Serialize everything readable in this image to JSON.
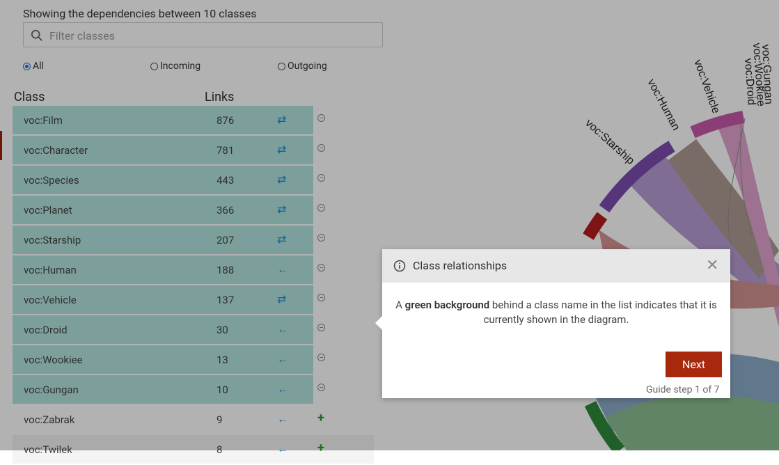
{
  "header": {
    "summary": "Showing the dependencies between 10 classes",
    "filter_placeholder": "Filter classes"
  },
  "filters": {
    "all": "All",
    "incoming": "Incoming",
    "outgoing": "Outgoing",
    "selected": "All"
  },
  "table": {
    "col_class": "Class",
    "col_links": "Links",
    "rows": [
      {
        "name": "voc:Film",
        "links": "876",
        "dir": "⇄",
        "shown": true
      },
      {
        "name": "voc:Character",
        "links": "781",
        "dir": "⇄",
        "shown": true
      },
      {
        "name": "voc:Species",
        "links": "443",
        "dir": "⇄",
        "shown": true
      },
      {
        "name": "voc:Planet",
        "links": "366",
        "dir": "⇄",
        "shown": true
      },
      {
        "name": "voc:Starship",
        "links": "207",
        "dir": "⇄",
        "shown": true
      },
      {
        "name": "voc:Human",
        "links": "188",
        "dir": "←",
        "shown": true
      },
      {
        "name": "voc:Vehicle",
        "links": "137",
        "dir": "⇄",
        "shown": true
      },
      {
        "name": "voc:Droid",
        "links": "30",
        "dir": "←",
        "shown": true
      },
      {
        "name": "voc:Wookiee",
        "links": "13",
        "dir": "←",
        "shown": true
      },
      {
        "name": "voc:Gungan",
        "links": "10",
        "dir": "←",
        "shown": true
      },
      {
        "name": "voc:Zabrak",
        "links": "9",
        "dir": "←",
        "shown": false
      },
      {
        "name": "voc:Twilek",
        "links": "8",
        "dir": "←",
        "shown": false
      }
    ]
  },
  "diagram": {
    "labels": [
      "voc:Starship",
      "voc:Human",
      "voc:Vehicle",
      "voc:Droid",
      "voc:Wookiee",
      "voc:Gungan"
    ]
  },
  "guide": {
    "title": "Class relationships",
    "body_bold": "green background",
    "body_pre": "A ",
    "body_post": " behind a class name in the list indicates that it is currently shown in the diagram.",
    "next_label": "Next",
    "step": "Guide step 1 of 7"
  },
  "colors": {
    "shown_row": "#b4e4df",
    "accent_button": "#a8280e",
    "link_icon": "#1a8ad3"
  }
}
